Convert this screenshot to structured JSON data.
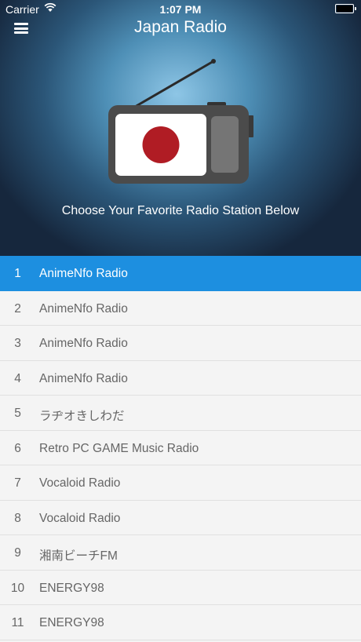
{
  "status_bar": {
    "carrier": "Carrier",
    "time": "1:07 PM"
  },
  "header": {
    "title": "Japan Radio",
    "menu_icon": "hamburger-menu-icon"
  },
  "hero": {
    "subtitle": "Choose Your Favorite Radio Station Below",
    "illustration": "radio-with-japan-flag"
  },
  "colors": {
    "active_row": "#1d8fe0",
    "flag_red": "#b01c24",
    "radio_body": "#4b4b4b"
  },
  "stations": [
    {
      "number": "1",
      "name": "AnimeNfo Radio",
      "active": true
    },
    {
      "number": "2",
      "name": "AnimeNfo Radio"
    },
    {
      "number": "3",
      "name": "AnimeNfo Radio"
    },
    {
      "number": "4",
      "name": "AnimeNfo Radio"
    },
    {
      "number": "5",
      "name": "ラヂオきしわだ"
    },
    {
      "number": "6",
      "name": "Retro PC GAME Music Radio"
    },
    {
      "number": "7",
      "name": "Vocaloid Radio"
    },
    {
      "number": "8",
      "name": "Vocaloid Radio"
    },
    {
      "number": "9",
      "name": "湘南ビーチFM"
    },
    {
      "number": "10",
      "name": "ENERGY98"
    },
    {
      "number": "11",
      "name": "ENERGY98"
    }
  ]
}
